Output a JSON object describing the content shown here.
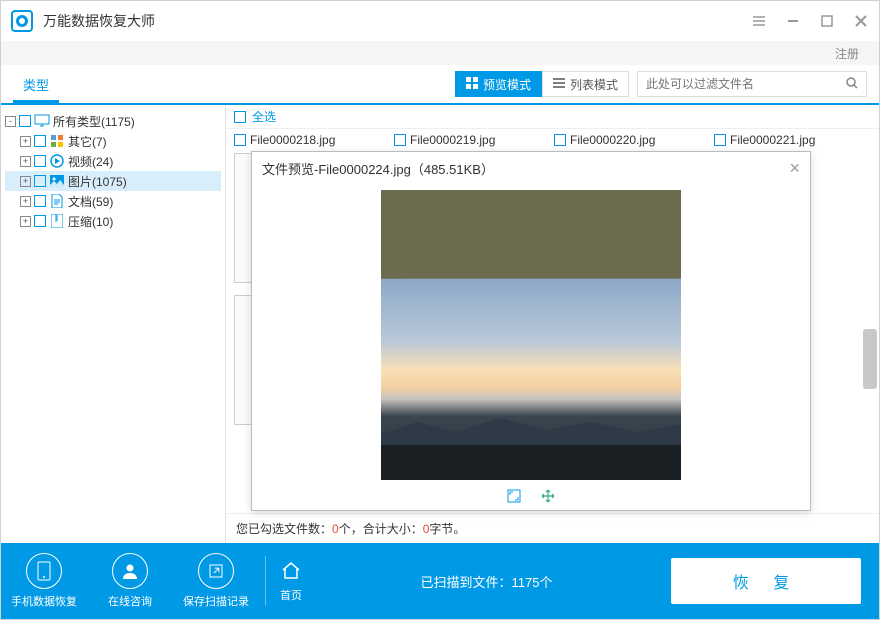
{
  "app": {
    "title": "万能数据恢复大师",
    "register": "注册"
  },
  "toolbar": {
    "type_tab": "类型",
    "preview_mode": "预览模式",
    "list_mode": "列表模式",
    "filter_placeholder": "此处可以过滤文件名"
  },
  "tree": {
    "root": "所有类型(1175)",
    "other": "其它(7)",
    "video": "视频(24)",
    "image": "图片(1075)",
    "doc": "文档(59)",
    "zip": "压缩(10)"
  },
  "content": {
    "select_all": "全选",
    "files": [
      "File0000218.jpg",
      "File0000219.jpg",
      "File0000220.jpg",
      "File0000221.jpg"
    ]
  },
  "preview": {
    "title": "文件预览-File0000224.jpg（485.51KB）"
  },
  "status": {
    "prefix": "您已勾选文件数：",
    "count": "0",
    "count_suffix": "个，合计大小：",
    "size": "0",
    "size_suffix": "字节。"
  },
  "footer": {
    "phone": "手机数据恢复",
    "online": "在线咨询",
    "save": "保存扫描记录",
    "home": "首页",
    "scan": "已扫描到文件：1175个",
    "recover": "恢 复"
  }
}
